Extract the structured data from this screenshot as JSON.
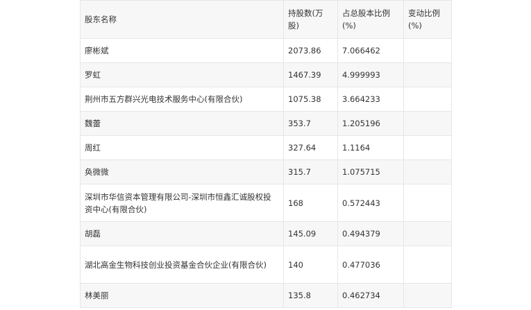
{
  "table": {
    "headers": [
      "股东名称",
      "持股数(万股)",
      "占总股本比例(%)",
      "变动比例(%)"
    ],
    "rows": [
      {
        "name": "廖彬斌",
        "shares": "2073.86",
        "ratio": "7.066462",
        "change": ""
      },
      {
        "name": "罗虹",
        "shares": "1467.39",
        "ratio": "4.999993",
        "change": ""
      },
      {
        "name": "荆州市五方群兴光电技术服务中心(有限合伙)",
        "shares": "1075.38",
        "ratio": "3.664233",
        "change": ""
      },
      {
        "name": "魏蕾",
        "shares": "353.7",
        "ratio": "1.205196",
        "change": ""
      },
      {
        "name": "周红",
        "shares": "327.64",
        "ratio": "1.1164",
        "change": ""
      },
      {
        "name": "奂微微",
        "shares": "315.7",
        "ratio": "1.075715",
        "change": ""
      },
      {
        "name": "深圳市华信资本管理有限公司-深圳市恒鑫汇诚股权投资中心(有限合伙)",
        "shares": "168",
        "ratio": "0.572443",
        "change": ""
      },
      {
        "name": "胡磊",
        "shares": "145.09",
        "ratio": "0.494379",
        "change": ""
      },
      {
        "name": "湖北高金生物科技创业投资基金合伙企业(有限合伙)",
        "shares": "140",
        "ratio": "0.477036",
        "change": ""
      },
      {
        "name": "林美丽",
        "shares": "135.8",
        "ratio": "0.462734",
        "change": ""
      }
    ]
  }
}
